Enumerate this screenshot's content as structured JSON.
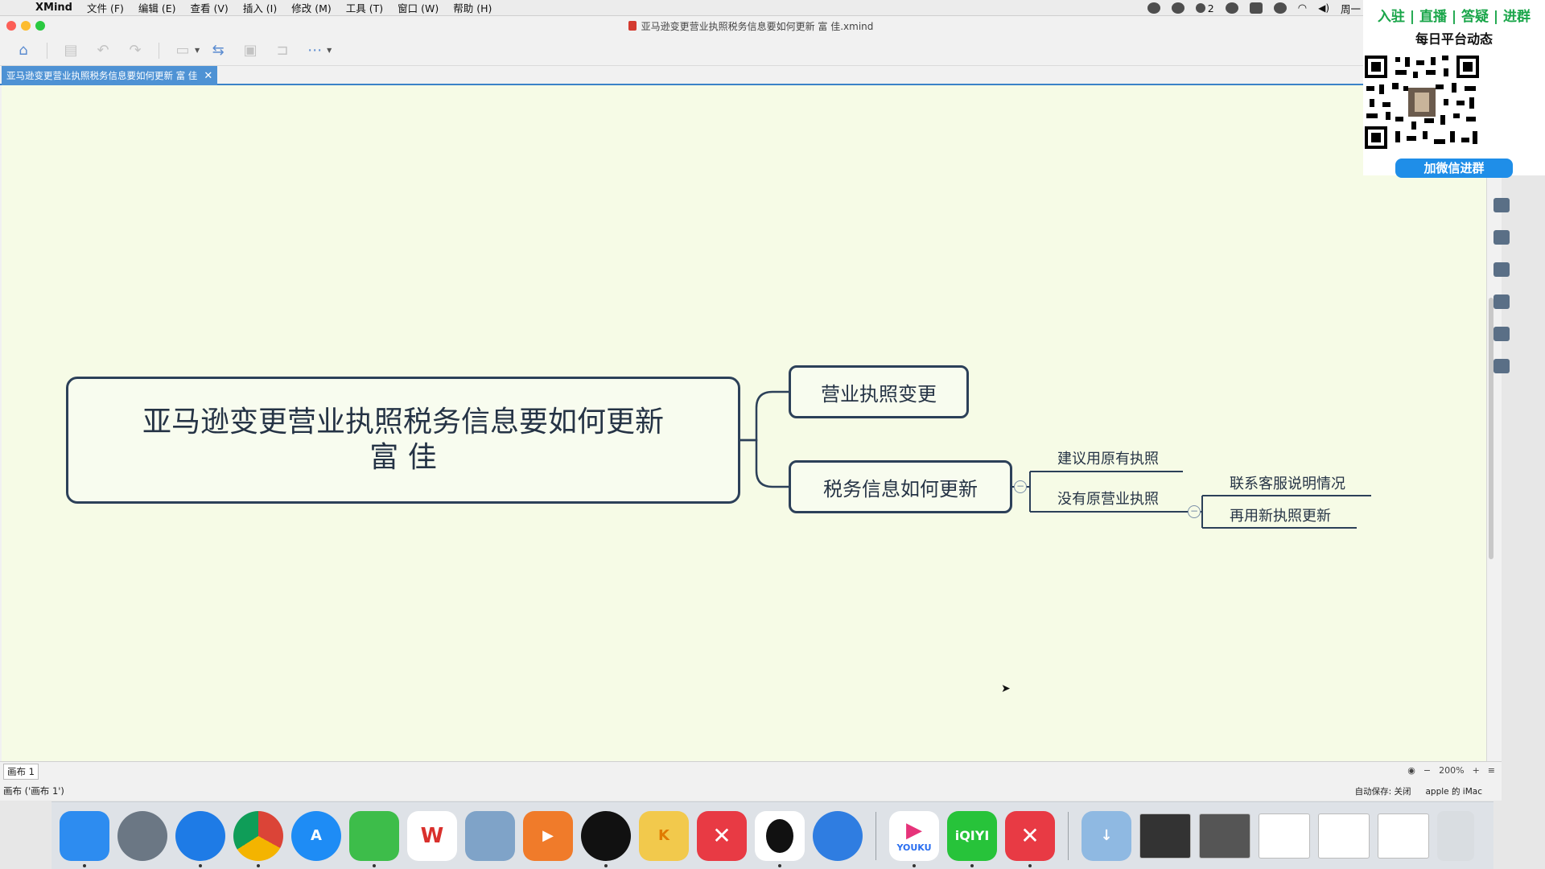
{
  "menubar": {
    "app_name": "XMind",
    "menus": [
      "文件 (F)",
      "编辑 (E)",
      "查看 (V)",
      "插入 (I)",
      "修改 (M)",
      "工具 (T)",
      "窗口 (W)",
      "帮助 (H)"
    ],
    "notification_count": "2",
    "clock": "周一 下午"
  },
  "window": {
    "title": "亚马逊变更营业执照税务信息要如何更新 富 佳.xmind",
    "doc_tab": "亚马逊变更营业执照税务信息要如何更新 富 佳",
    "doc_tab_close": "✕"
  },
  "mindmap": {
    "central_line1": "亚马逊变更营业执照税务信息要如何更新",
    "central_line2": "富 佳",
    "main1": "营业执照变更",
    "main2": "税务信息如何更新",
    "sub1": "建议用原有执照",
    "sub2": "没有原营业执照",
    "sub2a": "联系客服说明情况",
    "sub2b": "再用新执照更新",
    "collapse_symbol": "−"
  },
  "sheet": {
    "tab": "画布 1",
    "zoom": "200%",
    "zoom_minus": "−",
    "zoom_plus": "+"
  },
  "status": {
    "left": "画布 ('画布 1')",
    "autosave": "自动保存: 关闭",
    "user": "apple 的 iMac"
  },
  "promo": {
    "top": "入驻 | 直播 | 答疑 | 进群",
    "subtitle": "每日平台动态",
    "button": "加微信进群"
  },
  "dock": {
    "apps": [
      {
        "name": "finder",
        "color": "#2d8cf0"
      },
      {
        "name": "launchpad",
        "color": "#6b7784"
      },
      {
        "name": "safari",
        "color": "#1e7be6"
      },
      {
        "name": "chrome",
        "color": "#e9eef3"
      },
      {
        "name": "app-store",
        "color": "#1e8cf5"
      },
      {
        "name": "wechat",
        "color": "#3dbd4a"
      },
      {
        "name": "wps",
        "color": "#ffffff"
      },
      {
        "name": "preview",
        "color": "#7fa3c8"
      },
      {
        "name": "infuse",
        "color": "#f07b2a"
      },
      {
        "name": "obs",
        "color": "#111111"
      },
      {
        "name": "kaola",
        "color": "#f2c94c"
      },
      {
        "name": "xmind",
        "color": "#e83a44"
      },
      {
        "name": "qq",
        "color": "#ffffff"
      },
      {
        "name": "qq-browser",
        "color": "#2f7de1"
      },
      {
        "name": "youku",
        "color": "#ffffff"
      },
      {
        "name": "iqiyi",
        "color": "#27c33a"
      },
      {
        "name": "xmind-zen",
        "color": "#e83a44"
      }
    ],
    "youku_label": "YOUKU",
    "iqiyi_label": "iQIYI"
  }
}
